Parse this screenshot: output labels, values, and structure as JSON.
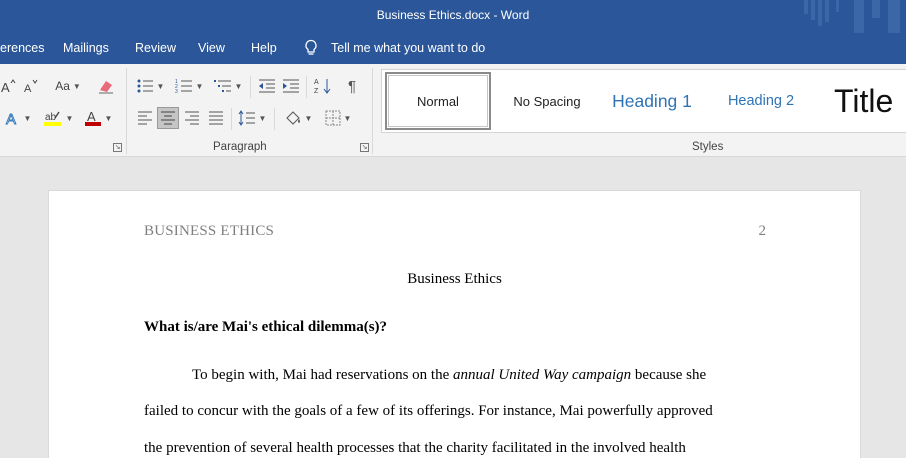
{
  "window": {
    "title": "Business Ethics.docx  -  Word"
  },
  "menu": {
    "items": [
      "erences",
      "Mailings",
      "Review",
      "View",
      "Help"
    ],
    "tell_me": "Tell me what you want to do"
  },
  "ribbon": {
    "font_group": {
      "change_case_label": "Aa"
    },
    "paragraph_group": {
      "label": "Paragraph"
    },
    "styles_group": {
      "label": "Styles",
      "items": [
        "Normal",
        "No Spacing",
        "Heading 1",
        "Heading 2",
        "Title"
      ]
    },
    "colors": {
      "highlight": "#ffff00",
      "font_color": "#c00000",
      "accent": "#2b579a",
      "heading": "#2e74b5"
    }
  },
  "document": {
    "running_head": "BUSINESS ETHICS",
    "page_number": "2",
    "title": "Business Ethics",
    "heading": "What is/are Mai's ethical dilemma(s)?",
    "lines": [
      {
        "before": "To begin with, Mai had reservations on the ",
        "italic": "annual United Way campaign",
        "after": " because she"
      },
      {
        "text": "failed to concur with the goals of a few of its offerings. For instance, Mai powerfully approved"
      },
      {
        "text": "the prevention of several health processes that the charity facilitated in the involved health"
      }
    ]
  }
}
